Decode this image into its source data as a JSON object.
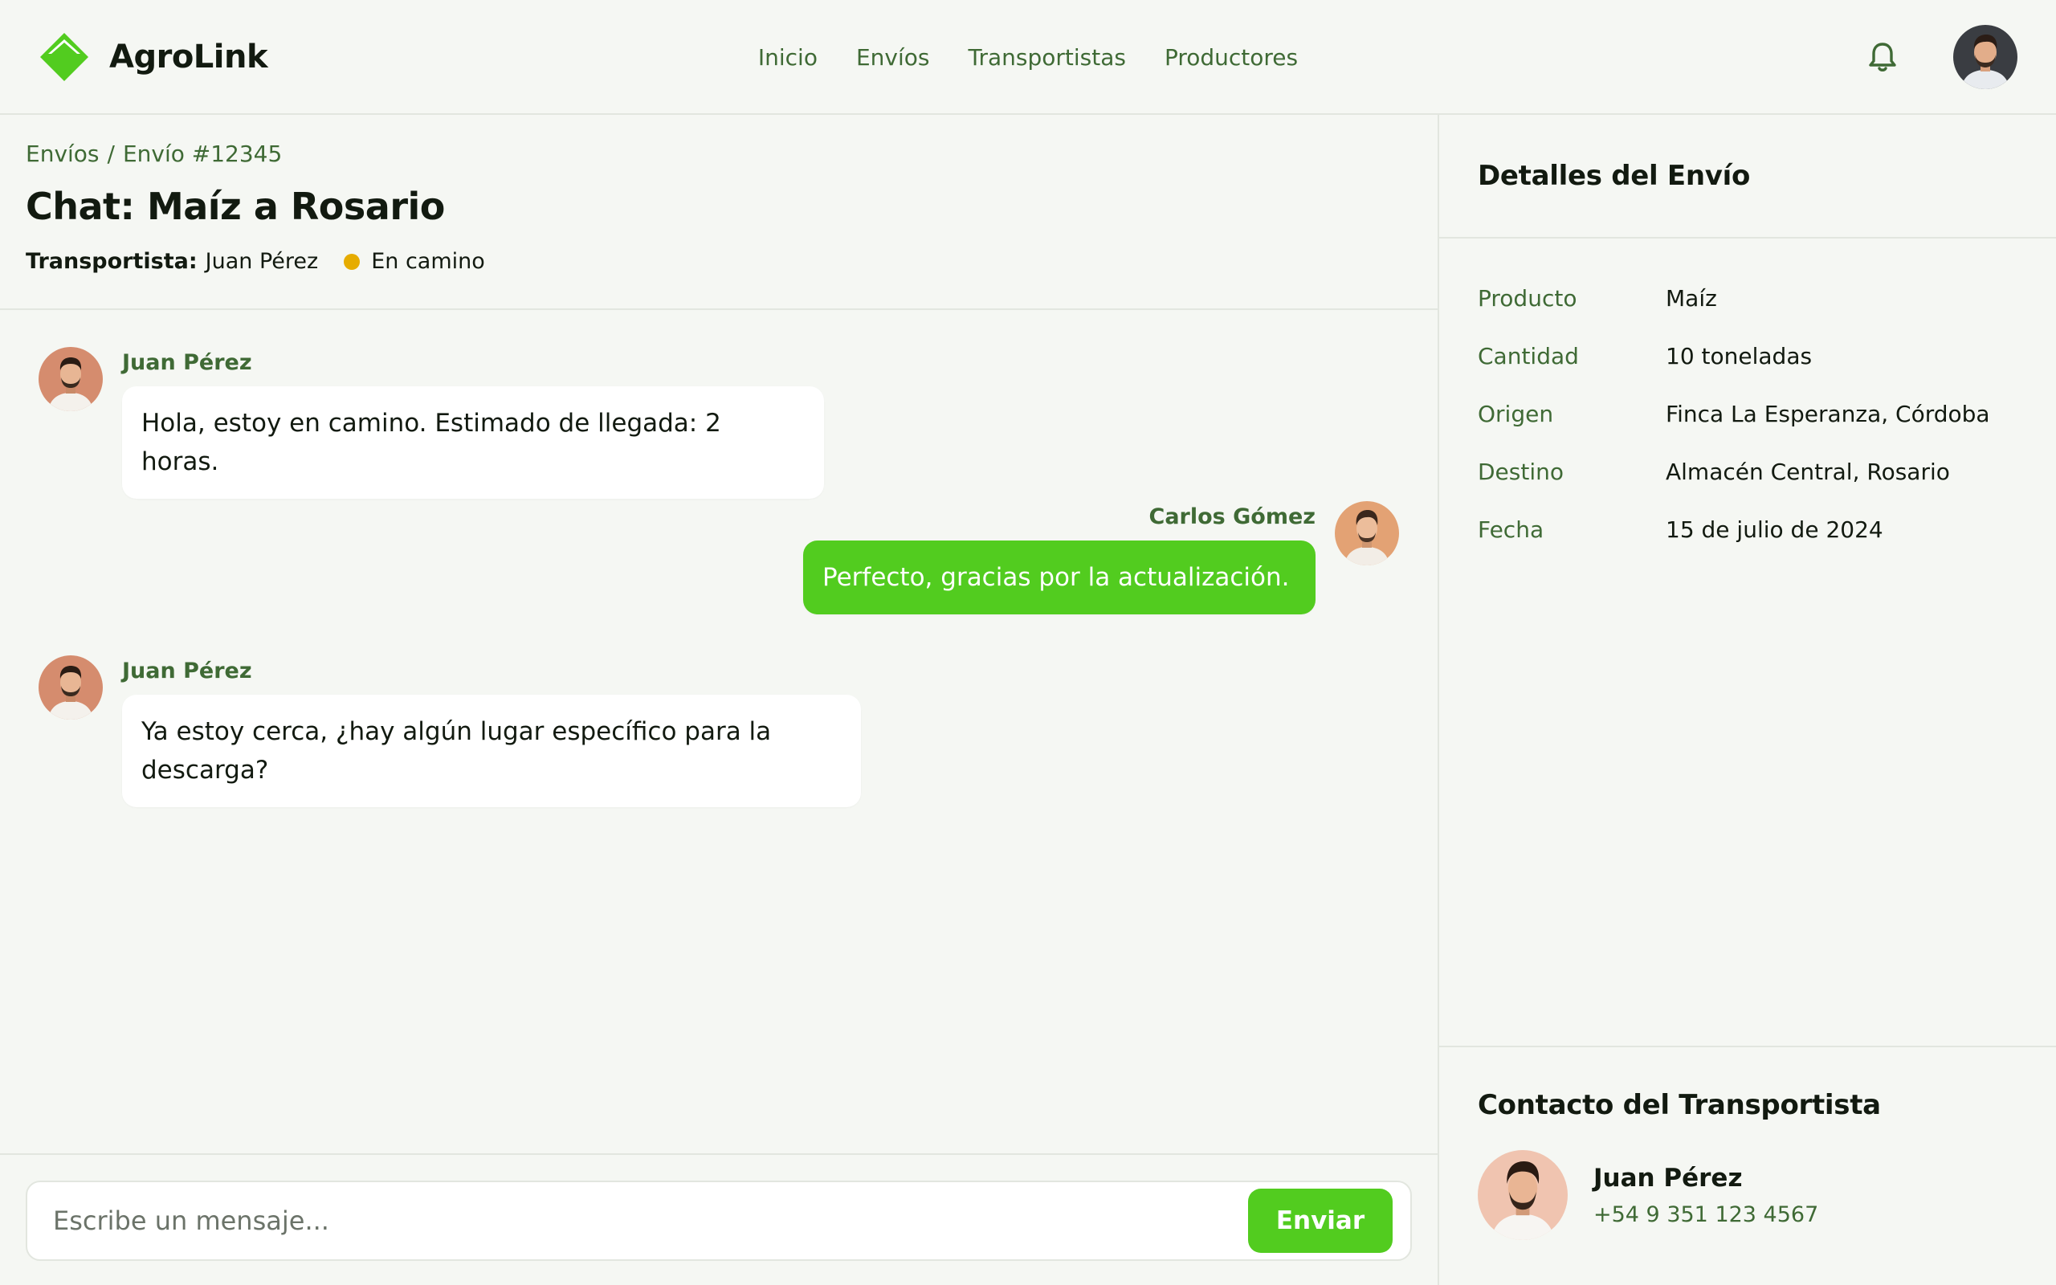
{
  "app": {
    "name": "AgroLink",
    "accent": "#52cc1f",
    "text_green": "#3f6a35"
  },
  "nav": [
    {
      "label": "Inicio"
    },
    {
      "label": "Envíos"
    },
    {
      "label": "Transportistas"
    },
    {
      "label": "Productores"
    }
  ],
  "header": {
    "notifications_icon": "bell-icon",
    "user_avatar": "avatar"
  },
  "breadcrumb": {
    "parent": "Envíos",
    "separator": "/",
    "current": "Envío #12345"
  },
  "page": {
    "title": "Chat: Maíz a Rosario",
    "carrier_label": "Transportista:",
    "carrier_name": "Juan Pérez",
    "status": "En camino",
    "status_color": "#e6ac00"
  },
  "messages": [
    {
      "sender": "Juan Pérez",
      "text": "Hola, estoy en camino. Estimado de llegada: 2 horas.",
      "side": "left"
    },
    {
      "sender": "Carlos Gómez",
      "text": "Perfecto, gracias por la actualización.",
      "side": "right"
    },
    {
      "sender": "Juan Pérez",
      "text": "Ya estoy cerca, ¿hay algún lugar específico para la descarga?",
      "side": "left"
    }
  ],
  "composer": {
    "placeholder": "Escribe un mensaje...",
    "send_label": "Enviar"
  },
  "details": {
    "title": "Detalles del Envío",
    "rows": [
      {
        "label": "Producto",
        "value": "Maíz"
      },
      {
        "label": "Cantidad",
        "value": "10 toneladas"
      },
      {
        "label": "Origen",
        "value": "Finca La Esperanza, Córdoba"
      },
      {
        "label": "Destino",
        "value": "Almacén Central, Rosario"
      },
      {
        "label": "Fecha",
        "value": "15 de julio de 2024"
      }
    ]
  },
  "contact": {
    "title": "Contacto del Transportista",
    "name": "Juan Pérez",
    "phone": "+54 9 351 123 4567"
  }
}
